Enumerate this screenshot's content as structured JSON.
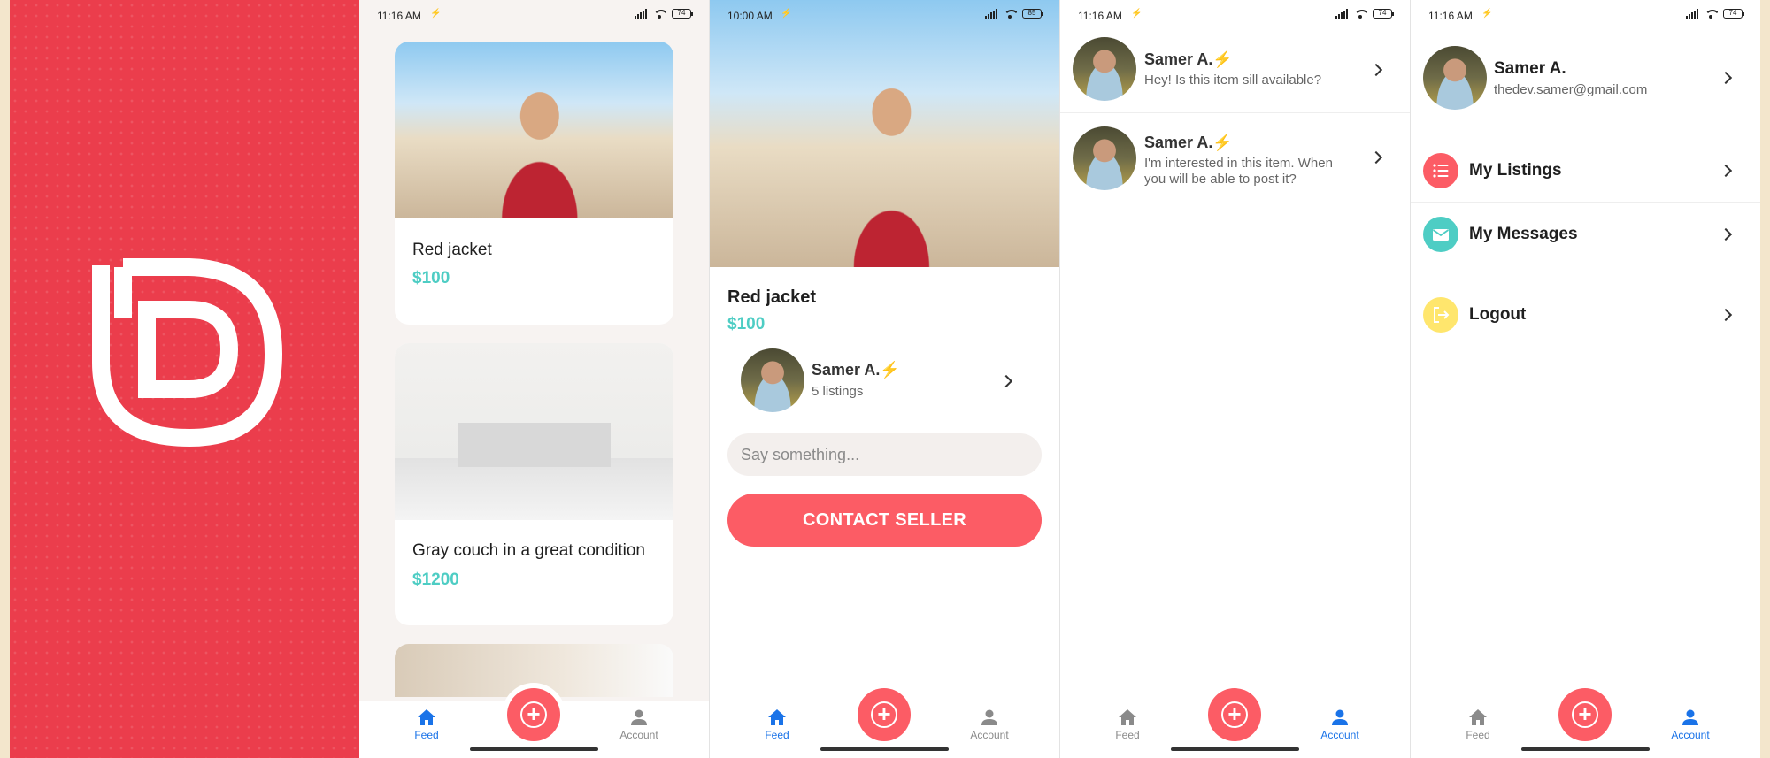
{
  "status": {
    "time_a": "11:16 AM",
    "time_b": "10:00 AM",
    "battery_a": "74",
    "battery_b": "85"
  },
  "splash": {
    "logo_icon": "d-logo-icon"
  },
  "feed": {
    "listings": [
      {
        "title": "Red jacket",
        "price": "$100"
      },
      {
        "title": "Gray couch in a great condition",
        "price": "$1200"
      }
    ]
  },
  "detail": {
    "title": "Red jacket",
    "price": "$100",
    "seller_name": "Samer A.⚡",
    "seller_listings": "5 listings",
    "message_placeholder": "Say something...",
    "contact_label": "CONTACT SELLER"
  },
  "messages": [
    {
      "name": "Samer A.⚡",
      "text": "Hey! Is this item sill available?"
    },
    {
      "name": "Samer A.⚡",
      "text": "I'm interested in this item. When you will be able to post it?"
    }
  ],
  "account": {
    "name": "Samer A.",
    "email": "thedev.samer@gmail.com",
    "menu": [
      {
        "label": "My Listings",
        "icon": "list-icon",
        "color": "#fc5c65"
      },
      {
        "label": "My Messages",
        "icon": "email-icon",
        "color": "#4ecdc4"
      },
      {
        "label": "Logout",
        "icon": "logout-icon",
        "color": "#ffe66d"
      }
    ]
  },
  "tabs": {
    "feed": "Feed",
    "account": "Account"
  },
  "colors": {
    "primary": "#fc5c65",
    "secondary": "#4ecdc4",
    "active_tab": "#1a73e8"
  }
}
